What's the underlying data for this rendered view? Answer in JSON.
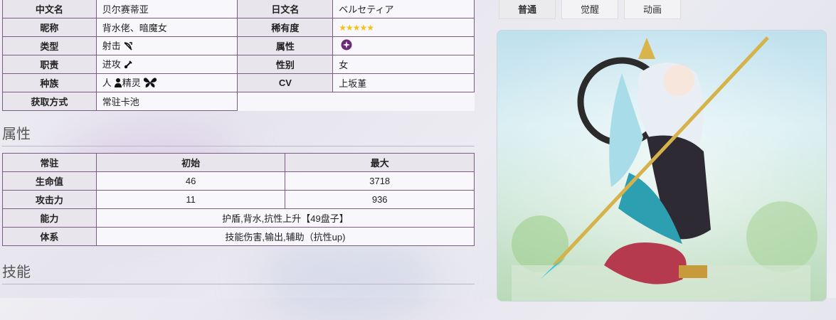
{
  "info": {
    "rows": [
      {
        "k1": "中文名",
        "v1": "贝尔赛蒂亚",
        "k2": "日文名",
        "v2": "ベルセティア"
      },
      {
        "k1": "昵称",
        "v1": "背水佬、暗魔女",
        "k2": "稀有度",
        "v2": "★★★★★"
      },
      {
        "k1": "类型",
        "v1": "射击",
        "k2": "属性",
        "v2": ""
      },
      {
        "k1": "职责",
        "v1": "进攻",
        "k2": "性别",
        "v2": "女"
      },
      {
        "k1": "种族",
        "v1": "人",
        "v1b": "精灵",
        "k2": "CV",
        "v2": "上坂堇"
      }
    ],
    "obtain_label": "获取方式",
    "obtain_value": "常驻卡池"
  },
  "sections": {
    "attr": "属性",
    "skill": "技能"
  },
  "stats": {
    "headers": [
      "常驻",
      "初始",
      "最大"
    ],
    "hp": {
      "label": "生命值",
      "init": "46",
      "max": "3718"
    },
    "atk": {
      "label": "攻击力",
      "init": "11",
      "max": "936"
    },
    "ability": {
      "label": "能力",
      "value": "护盾,背水,抗性上升【49盘子】"
    },
    "system": {
      "label": "体系",
      "value": "技能伤害,输出,辅助（抗性up)"
    }
  },
  "tabs": [
    "普通",
    "觉醒",
    "动画"
  ],
  "colors": {
    "border": "#7c5c85",
    "header_bg": "#e8e6ec",
    "star": "#f2c21b"
  }
}
